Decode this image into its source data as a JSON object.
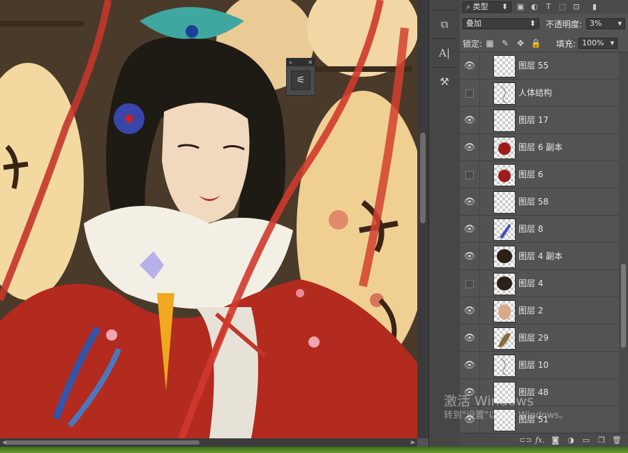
{
  "filter_bar": {
    "kind_label": "类型",
    "search_icon": "search-icon"
  },
  "blend": {
    "mode": "叠加",
    "opacity_label": "不透明度:",
    "opacity_value": "3%"
  },
  "lock": {
    "label": "锁定:",
    "fill_label": "填充:",
    "fill_value": "100%"
  },
  "layers": [
    {
      "name": "图层 55",
      "visible": true,
      "thumb": "blank"
    },
    {
      "name": "人体结构",
      "visible": false,
      "thumb": "sketch"
    },
    {
      "name": "图层 17",
      "visible": true,
      "thumb": "blank"
    },
    {
      "name": "图层 6 副本",
      "visible": true,
      "thumb": "red"
    },
    {
      "name": "图层 6",
      "visible": false,
      "thumb": "red"
    },
    {
      "name": "图层 58",
      "visible": true,
      "thumb": "blank"
    },
    {
      "name": "图层 8",
      "visible": true,
      "thumb": "blue"
    },
    {
      "name": "图层 4 副本",
      "visible": true,
      "thumb": "hair"
    },
    {
      "name": "图层 4",
      "visible": false,
      "thumb": "hair"
    },
    {
      "name": "图层 2",
      "visible": true,
      "thumb": "skin"
    },
    {
      "name": "图层 29",
      "visible": true,
      "thumb": "brown"
    },
    {
      "name": "图层 10",
      "visible": true,
      "thumb": "sketch"
    },
    {
      "name": "图层 48",
      "visible": true,
      "thumb": "blank"
    },
    {
      "name": "图层 51",
      "visible": true,
      "thumb": "blank"
    }
  ],
  "footer_icons": [
    "link-icon",
    "fx-icon",
    "mask-icon",
    "adjustment-icon",
    "folder-icon",
    "new-layer-icon",
    "trash-icon"
  ],
  "footer_fx": "fx.",
  "watermark": {
    "line1": "激活 Windows",
    "line2": "转到\"设置\"以激活 Windows。"
  },
  "colors": {
    "panel": "#535353",
    "dark": "#3c3c3c",
    "accent_red": "#b32a1e"
  }
}
